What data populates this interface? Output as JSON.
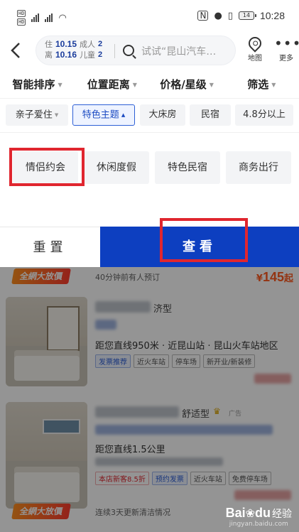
{
  "status_bar": {
    "sim1": "HD",
    "sim2": "HD",
    "battery": "14",
    "time": "10:28"
  },
  "header": {
    "checkin_label": "住",
    "checkin_date": "10.15",
    "checkout_label": "离",
    "checkout_date": "10.16",
    "adult_label": "成人",
    "adult_count": "2",
    "child_label": "儿童",
    "child_count": "2",
    "search_placeholder": "试试“昆山汽车…",
    "map_label": "地图",
    "more_label": "更多"
  },
  "sort_bar": {
    "items": [
      "智能排序",
      "位置距离",
      "价格/星级",
      "筛选"
    ]
  },
  "filter_chips": {
    "items": [
      "亲子爱住",
      "特色主题",
      "大床房",
      "民宿",
      "4.8分以上"
    ],
    "active_index": 1
  },
  "theme_options": {
    "items": [
      "情侣约会",
      "休闲度假",
      "特色民宿",
      "商务出行"
    ],
    "highlighted_index": 0
  },
  "actions": {
    "reset_label": "重置",
    "view_label": "查看"
  },
  "hotel_list": {
    "top_promo": "全網大放價",
    "top_booked": "40分钟前有人预订",
    "top_price_symbol": "¥",
    "top_price": "145",
    "top_price_suffix": "起",
    "hotels": [
      {
        "name_suffix": "济型",
        "distance": "距您直线950米 · 近昆山站 · 昆山火车站地区",
        "tags": [
          "发票推荐",
          "近火车站",
          "停车场",
          "新开业/新装修"
        ]
      },
      {
        "name_suffix": "舒适型",
        "ad": "广告",
        "distance": "距您直线1.5公里",
        "tags": [
          "本店新客8.5折",
          "预约发票",
          "近火车站",
          "免费停车场"
        ],
        "promo": "全網大放價",
        "cleaning": "连续3天更新清洁情况"
      }
    ]
  },
  "watermark": {
    "brand": "Bai",
    "brand_tail": "du",
    "jingyan": "经验",
    "url": "jingyan.baidu.com"
  },
  "colors": {
    "primary": "#0d3fc0",
    "highlight_box": "#e0262f",
    "price": "#ff5a1f"
  }
}
